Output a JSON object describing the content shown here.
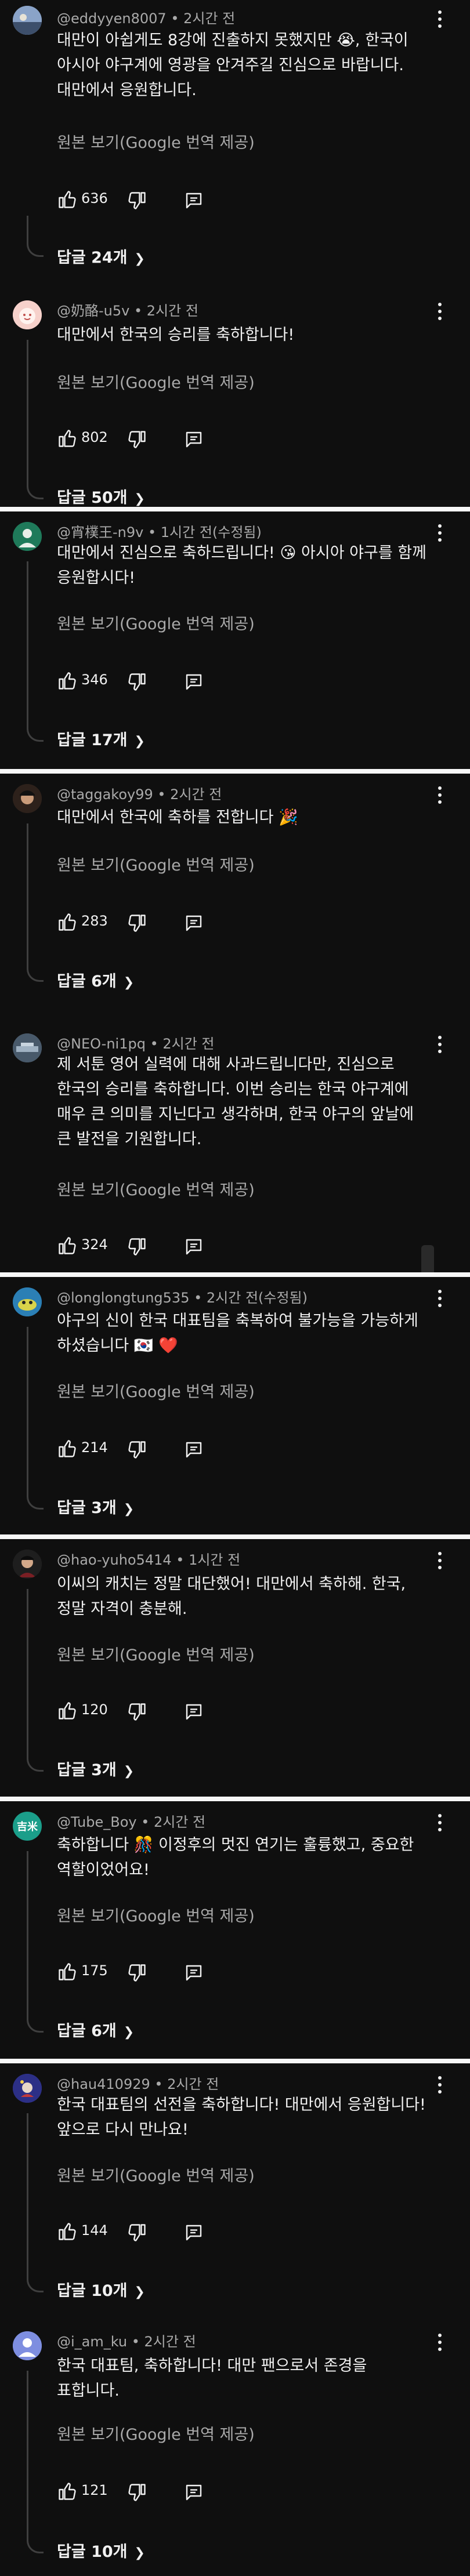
{
  "translate_label": "원본 보기(Google 번역 제공)",
  "comments": [
    {
      "meta": "@eddyyen8007 • 2시간 전",
      "lines": [
        "대만이 아쉽게도 8강에 진출하지 못했지만 😭, 한국이",
        "아시아 야구계에 영광을 안겨주길 진심으로 바랍니다.",
        "대만에서 응원합니다."
      ],
      "likes": "636",
      "replies": "답글 24개"
    },
    {
      "meta": "@奶酪-u5v • 2시간 전",
      "lines": [
        "대만에서 한국의 승리를 축하합니다!"
      ],
      "likes": "802",
      "replies": "답글 50개"
    },
    {
      "meta": "@宵樸王-n9v • 1시간 전(수정됨)",
      "lines": [
        "대만에서 진심으로 축하드립니다! 😘 아시아 야구를 함께",
        "응원합시다!"
      ],
      "likes": "346",
      "replies": "답글 17개"
    },
    {
      "meta": "@taggakoy99 • 2시간 전",
      "lines": [
        "대만에서 한국에 축하를 전합니다 🎉"
      ],
      "likes": "283",
      "replies": "답글 6개"
    },
    {
      "meta": "@NEO-ni1pq • 2시간 전",
      "lines": [
        "제 서툰 영어 실력에 대해 사과드립니다만, 진심으로",
        "한국의 승리를 축하합니다. 이번 승리는 한국 야구계에",
        "매우 큰 의미를 지닌다고 생각하며, 한국 야구의 앞날에",
        "큰 발전을 기원합니다."
      ],
      "likes": "324",
      "replies": ""
    },
    {
      "meta": "@longlongtung535 • 2시간 전(수정됨)",
      "lines": [
        "야구의 신이 한국 대표팀을 축복하여 불가능을 가능하게",
        "하셨습니다 🇰🇷 ❤️"
      ],
      "likes": "214",
      "replies": "답글 3개"
    },
    {
      "meta": "@hao-yuho5414 • 1시간 전",
      "lines": [
        "이씨의 캐치는 정말 대단했어! 대만에서 축하해. 한국,",
        "정말 자격이 충분해."
      ],
      "likes": "120",
      "replies": "답글 3개"
    },
    {
      "meta": "@Tube_Boy • 2시간 전",
      "lines": [
        "축하합니다 🎊 이정후의 멋진 연기는 훌륭했고, 중요한",
        "역할이었어요!"
      ],
      "likes": "175",
      "replies": "답글 6개"
    },
    {
      "meta": "@hau410929 • 2시간 전",
      "lines": [
        "한국 대표팀의 선전을 축하합니다! 대만에서 응원합니다!",
        "앞으로 다시 만나요!"
      ],
      "likes": "144",
      "replies": "답글 10개"
    },
    {
      "meta": "@i_am_ku • 2시간 전",
      "lines": [
        "한국 대표팀, 축하합니다! 대만 팬으로서 존경을",
        "표합니다."
      ],
      "likes": "121",
      "replies": "답글 10개"
    }
  ],
  "avatars": [
    {
      "label": "",
      "color": "#6b7f9e"
    },
    {
      "label": "",
      "color": "#f2c6c0"
    },
    {
      "label": "",
      "color": "#1f7a5a"
    },
    {
      "label": "",
      "color": "#3a2a22"
    },
    {
      "label": "",
      "color": "#5a6b7a"
    },
    {
      "label": "",
      "color": "#2b7fb5"
    },
    {
      "label": "",
      "color": "#2a2a2a"
    },
    {
      "label": "吉米",
      "color": "#1b9e8a"
    },
    {
      "label": "",
      "color": "#3b3fa0"
    },
    {
      "label": "",
      "color": "#7e8ee0"
    }
  ]
}
